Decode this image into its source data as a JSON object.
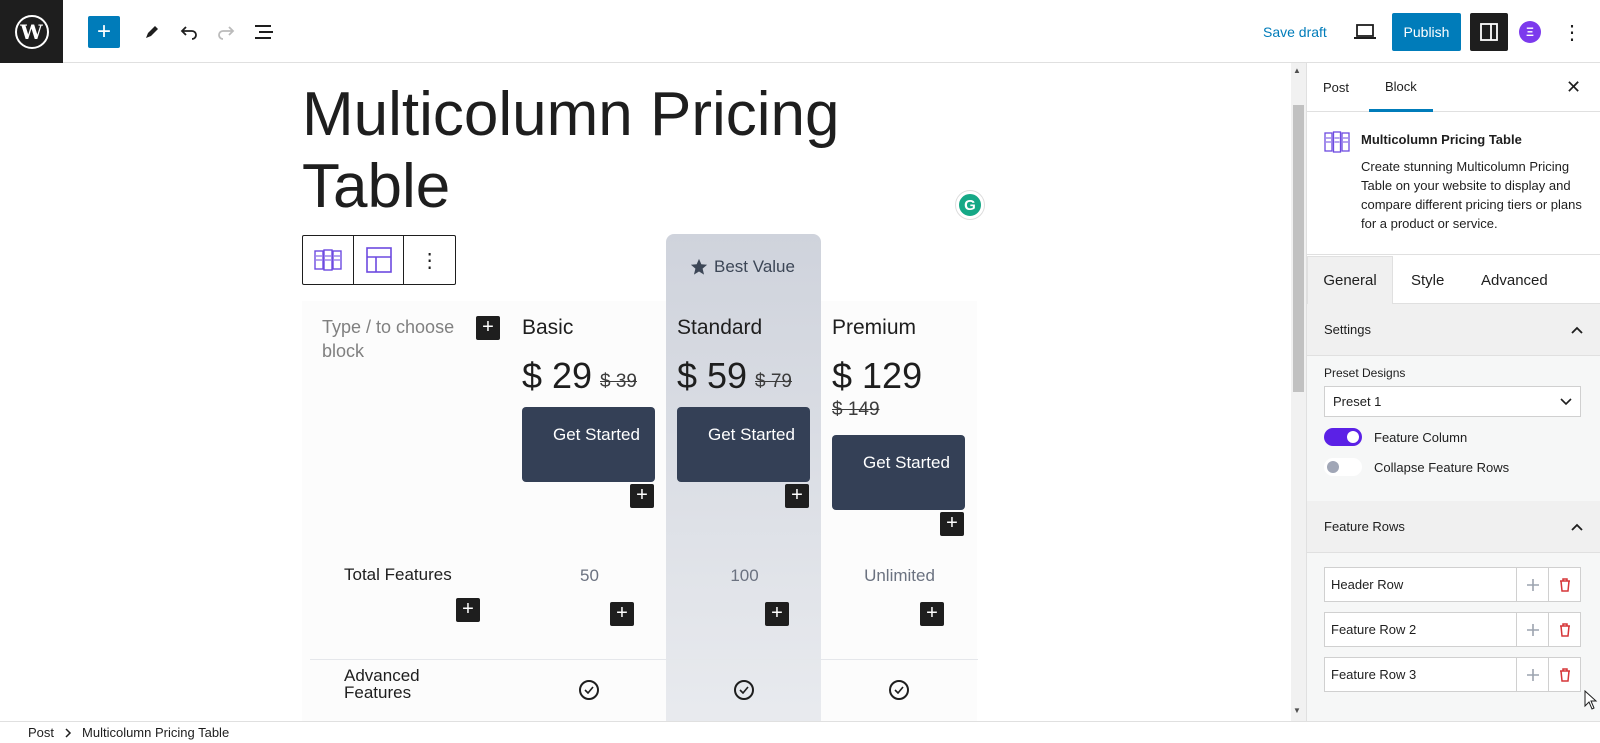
{
  "toolbar": {
    "save_draft": "Save draft",
    "publish": "Publish",
    "plugin_letter": "Ξ"
  },
  "post": {
    "title": "Multicolumn Pricing Table"
  },
  "pricing": {
    "best_value": "Best Value",
    "placeholder": "Type / to choose block",
    "plans": [
      {
        "name": "Basic",
        "price": "$ 29",
        "old_price": "$ 39",
        "button": "Get Started",
        "total_features": "50"
      },
      {
        "name": "Standard",
        "price": "$ 59",
        "old_price": "$ 79",
        "button": "Get Started",
        "total_features": "100"
      },
      {
        "name": "Premium",
        "price": "$ 129",
        "old_price": "$ 149",
        "button": "Get Started",
        "total_features": "Unlimited"
      }
    ],
    "feature_labels": [
      "Total Features",
      "Advanced Features"
    ]
  },
  "sidebar": {
    "tabs": [
      "Post",
      "Block"
    ],
    "block_title": "Multicolumn Pricing Table",
    "block_desc": "Create stunning Multicolumn Pricing Table on your website to display and compare different pricing tiers or plans for a product or service.",
    "inner_tabs": [
      "General",
      "Style",
      "Advanced"
    ],
    "settings_title": "Settings",
    "preset_label": "Preset Designs",
    "preset_value": "Preset 1",
    "feature_column_label": "Feature Column",
    "feature_column_on": true,
    "collapse_label": "Collapse Feature Rows",
    "collapse_on": false,
    "feature_rows_title": "Feature Rows",
    "rows": [
      "Header Row",
      "Feature Row 2",
      "Feature Row 3"
    ]
  },
  "breadcrumb": {
    "root": "Post",
    "current": "Multicolumn Pricing Table"
  },
  "colors": {
    "accent": "#007cba",
    "button_dark": "#344056",
    "toggle_on": "#5b21e6",
    "delete_red": "#d63638"
  }
}
